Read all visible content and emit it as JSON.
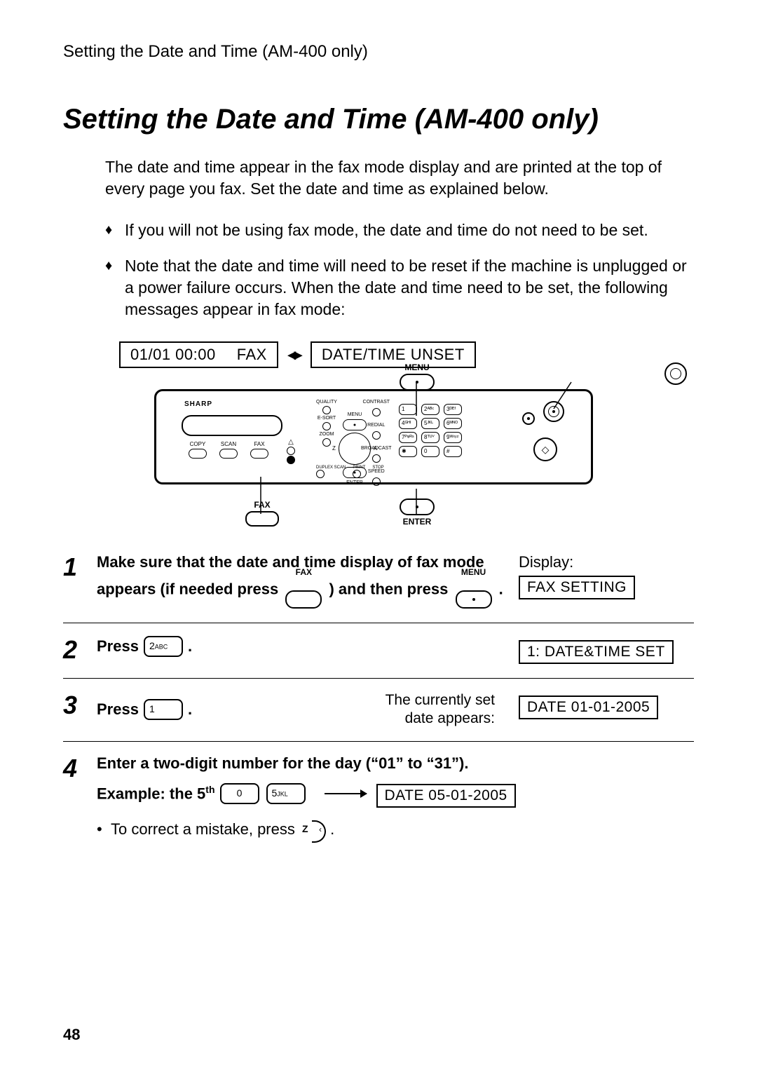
{
  "header": {
    "running": "Setting the Date and Time (AM-400 only)"
  },
  "title": "Setting the Date and Time (AM-400 only)",
  "intro": "The date and time appear in the fax mode display and are printed at the top of every page you fax. Set the date and time as explained below.",
  "bullets": [
    "If you will not be using fax mode, the date and time do not need to be set.",
    "Note that the date and time will need to be reset if the machine is unplugged or a power failure occurs. When the date and time need to be set, the following messages appear in fax mode:"
  ],
  "lcd": {
    "left_date": "01/01  00:00",
    "left_mode": "FAX",
    "right": "DATE/TIME UNSET"
  },
  "panel": {
    "brand": "SHARP",
    "modes": [
      "COPY",
      "SCAN",
      "FAX"
    ],
    "center_labels": {
      "quality": "QUALITY",
      "esort": "E-SORT",
      "menu": "MENU",
      "zoom": "ZOOM",
      "enter": "ENTER",
      "duplex": "DUPLEX SCAN",
      "print": "PRINT",
      "stop": "STOP"
    },
    "right_labels": {
      "contrast": "CONTRAST",
      "redial": "REDIAL",
      "broadcast": "BROADCAST",
      "speed": "SPEED"
    },
    "keys": [
      "1",
      "2ᴬᴮᶜ",
      "3ᴰᴱᶠ",
      "4ᴳᴴᴵ",
      "5ᴶᴷᴸ",
      "6ᴹᴺᴼ",
      "7ᴾᵠᴿˢ",
      "8ᵀᵁⱽ",
      "9ᵂˣʸᶻ",
      "✱",
      "0",
      "#"
    ]
  },
  "callouts": {
    "menu": "MENU",
    "enter": "ENTER",
    "fax": "FAX"
  },
  "steps": {
    "s1": {
      "num": "1",
      "text_a": "Make sure that the date and time display of fax mode appears (if needed press ",
      "text_b": ") and then press ",
      "fax_label": "FAX",
      "menu_label": "MENU",
      "period": ".",
      "side_title": "Display:",
      "side_box": "FAX SETTING"
    },
    "s2": {
      "num": "2",
      "press": "Press ",
      "key_main": "2",
      "key_sub": "ABC",
      "period": ".",
      "side_box": "1: DATE&TIME SET"
    },
    "s3": {
      "num": "3",
      "press": "Press ",
      "key_main": "1",
      "period": ".",
      "mid_a": "The currently set",
      "mid_b": "date appears:",
      "side_box": "DATE 01-01-2005"
    },
    "s4": {
      "num": "4",
      "line1": "Enter a two-digit number for the day (“01” to “31”).",
      "ex_label": "Example: the 5",
      "ex_sup": "th",
      "key0": "0",
      "key5": "5",
      "key5_sub": "JKL",
      "side_box": "DATE 05-01-2005",
      "correct": "To correct a mistake, press ",
      "z": "Z"
    }
  },
  "page_number": "48"
}
